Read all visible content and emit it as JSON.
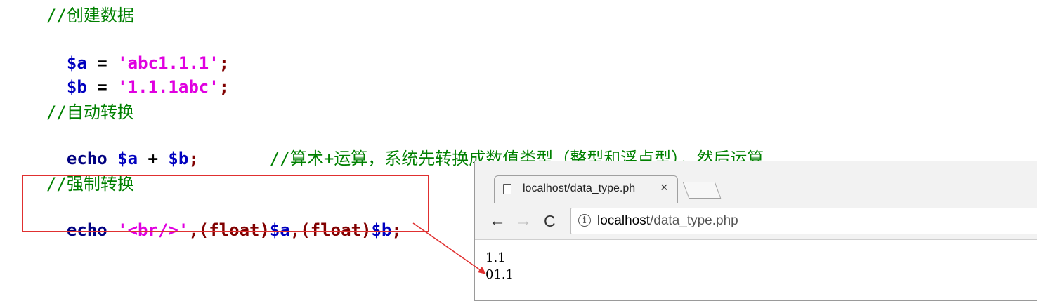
{
  "code": {
    "comment_create": "//创建数据",
    "line_a": {
      "var": "$a",
      "op": " = ",
      "str": "'abc1.1.1'",
      "end": ";"
    },
    "line_b": {
      "var": "$b",
      "op": " = ",
      "str": "'1.1.1abc'",
      "end": ";"
    },
    "comment_auto": "//自动转换",
    "line_echo_sum": {
      "kw": "echo ",
      "var_a": "$a",
      "op": " + ",
      "var_b": "$b",
      "end": ";",
      "comment": "       //算术+运算，系统先转换成数值类型（整型和浮点型），然后运算"
    },
    "comment_force": "//强制转换",
    "line_echo_cast": {
      "kw": "echo ",
      "str": "'<br/>'",
      "comma1": ",",
      "cast1": "(float)",
      "var_a": "$a",
      "comma2": ",",
      "cast2": "(float)",
      "var_b": "$b",
      "end": ";"
    }
  },
  "browser": {
    "tab_title": "localhost/data_type.ph",
    "tab_close": "×",
    "back": "←",
    "forward": "→",
    "reload": "C",
    "info": "i",
    "url_host": "localhost",
    "url_path": "/data_type.php",
    "output": [
      "1.1",
      "01.1"
    ]
  },
  "colors": {
    "highlight_box": "#e03030",
    "comment": "#008000",
    "variable": "#0000c0",
    "string": "#e000e0"
  }
}
